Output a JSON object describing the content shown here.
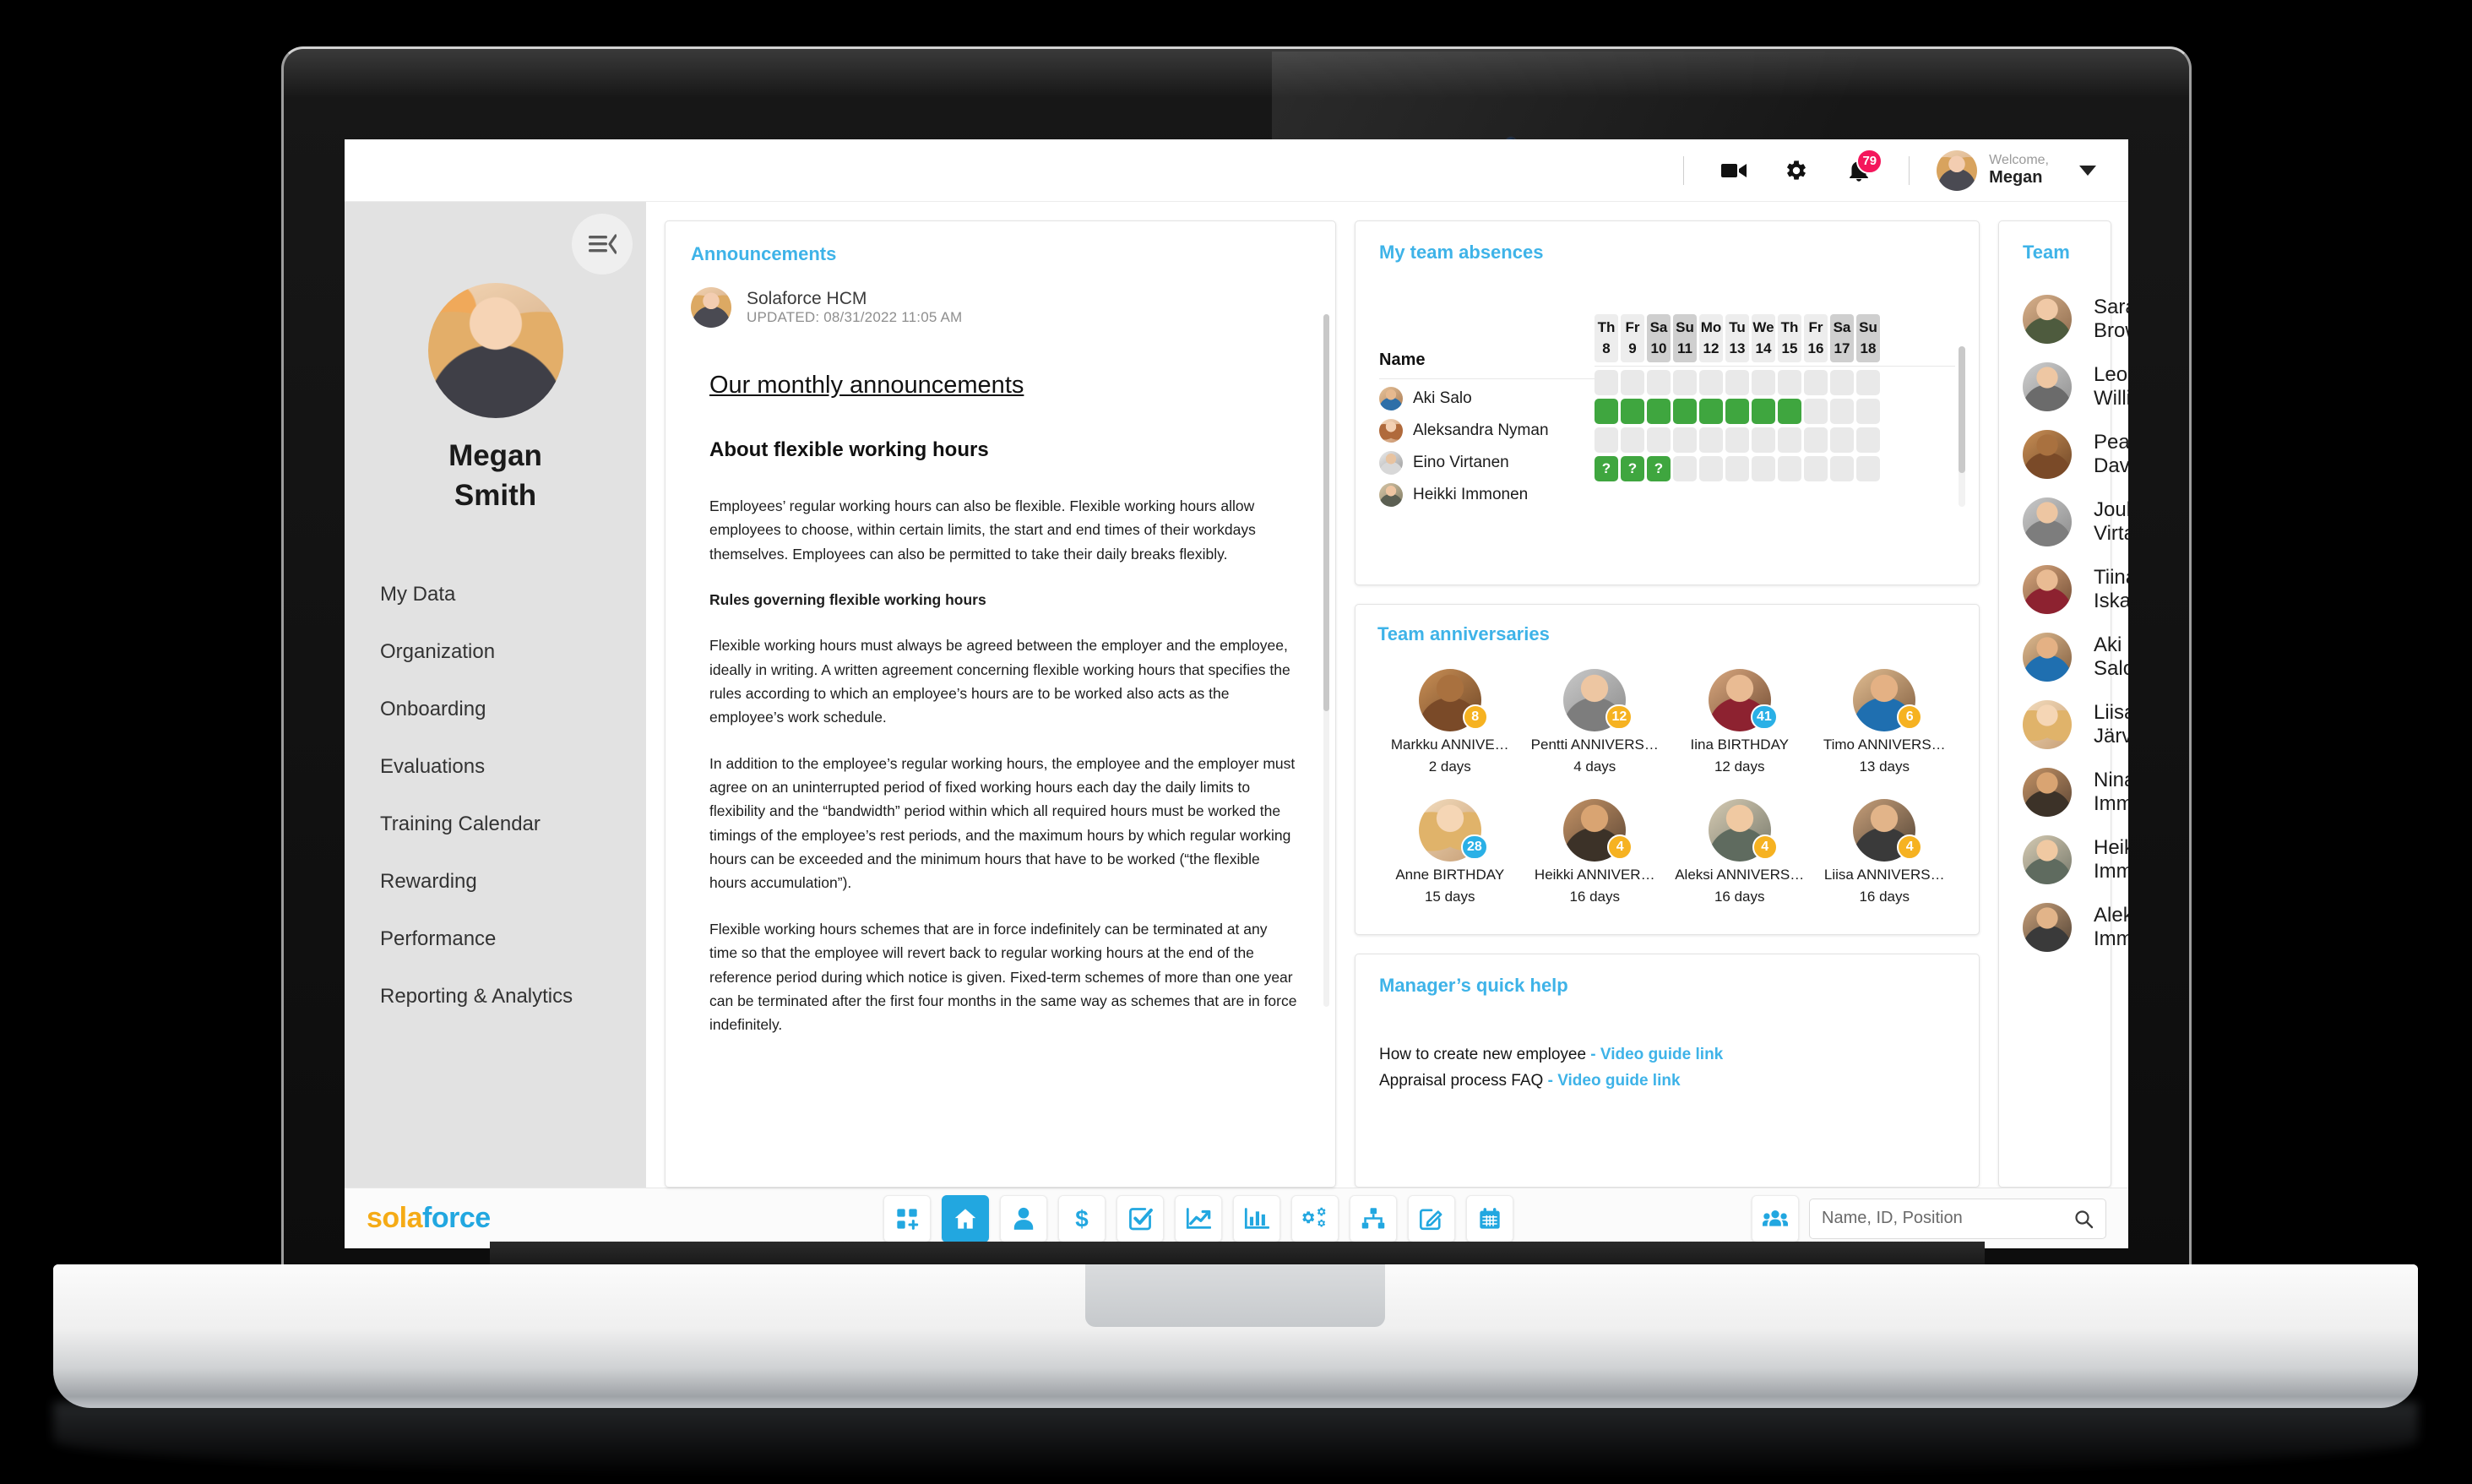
{
  "header": {
    "video_icon": "video-camera-icon",
    "settings_icon": "gear-icon",
    "notifications_icon": "bell-icon",
    "notification_count": "79",
    "welcome_label": "Welcome,",
    "user_name": "Megan",
    "dropdown_icon": "chevron-down-icon"
  },
  "sidebar": {
    "collapse_icon": "collapse-menu-icon",
    "profile": {
      "first_name": "Megan",
      "last_name": "Smith"
    },
    "items": [
      {
        "label": "My Data"
      },
      {
        "label": "Organization"
      },
      {
        "label": "Onboarding"
      },
      {
        "label": "Evaluations"
      },
      {
        "label": "Training Calendar"
      },
      {
        "label": "Rewarding"
      },
      {
        "label": "Performance"
      },
      {
        "label": "Reporting & Analytics"
      }
    ]
  },
  "announcements": {
    "title": "Announcements",
    "author": "Solaforce HCM",
    "updated": "UPDATED: 08/31/2022 11:05 AM",
    "heading": "Our monthly announcements",
    "subheading": "About flexible working hours",
    "paragraphs": [
      "Employees’ regular working hours can also be flexible. Flexible working hours allow employees to choose, within certain limits, the start and end times of their workdays themselves. Employees can also be permitted to take their daily breaks flexibly.",
      "Rules governing flexible working hours",
      "Flexible working hours must always be agreed between the employer and the employee, ideally in writing. A written agreement concerning flexible working hours that specifies the rules according to which an employee’s hours are to be worked also acts as the employee’s work schedule.",
      "In addition to the employee’s regular working hours, the employee and the employer must agree on an uninterrupted period of fixed working hours each day the daily limits to flexibility and the “bandwidth” period within which all required hours must be worked the timings of the employee’s rest periods, and the maximum hours by which regular working hours can be exceeded and the minimum hours that have to be worked (“the flexible hours accumulation”).",
      "Flexible working hours schemes that are in force indefinitely can be terminated at any time so that the employee will revert back to regular working hours at the end of the reference period during which notice is given. Fixed-term schemes of more than one year can be terminated after the first four months in the same way as schemes that are in force indefinitely."
    ]
  },
  "absences": {
    "title": "My team absences",
    "name_header": "Name",
    "days": [
      {
        "dow": "Th",
        "num": "8",
        "weekend": false
      },
      {
        "dow": "Fr",
        "num": "9",
        "weekend": false
      },
      {
        "dow": "Sa",
        "num": "10",
        "weekend": true
      },
      {
        "dow": "Su",
        "num": "11",
        "weekend": true
      },
      {
        "dow": "Mo",
        "num": "12",
        "weekend": false
      },
      {
        "dow": "Tu",
        "num": "13",
        "weekend": false
      },
      {
        "dow": "We",
        "num": "14",
        "weekend": false
      },
      {
        "dow": "Th",
        "num": "15",
        "weekend": false
      },
      {
        "dow": "Fr",
        "num": "16",
        "weekend": false
      },
      {
        "dow": "Sa",
        "num": "17",
        "weekend": true
      },
      {
        "dow": "Su",
        "num": "18",
        "weekend": true
      }
    ],
    "rows": [
      {
        "name": "Aki Salo",
        "cells": [
          "",
          "",
          "",
          "",
          "",
          "",
          "",
          "",
          "",
          "",
          ""
        ]
      },
      {
        "name": "Aleksandra Nyman",
        "cells": [
          "on",
          "on",
          "on",
          "on",
          "on",
          "on",
          "on",
          "on",
          "",
          "",
          ""
        ]
      },
      {
        "name": "Eino Virtanen",
        "cells": [
          "",
          "",
          "",
          "",
          "",
          "",
          "",
          "",
          "",
          "",
          ""
        ]
      },
      {
        "name": "Heikki Immonen",
        "cells": [
          "?",
          "?",
          "?",
          "",
          "",
          "",
          "",
          "",
          "",
          "",
          ""
        ]
      }
    ],
    "colors": {
      "absent": "#3fa63f",
      "empty": "#e9e9e9",
      "weekend_header": "#cfcfcf"
    }
  },
  "anniversaries": {
    "title": "Team anniversaries",
    "items": [
      {
        "name": "Markku ANNIVE…",
        "days": "2 days",
        "badge": "8",
        "badge_color": "#f6b221"
      },
      {
        "name": "Pentti ANNIVERS…",
        "days": "4 days",
        "badge": "12",
        "badge_color": "#f6b221"
      },
      {
        "name": "Iina BIRTHDAY",
        "days": "12 days",
        "badge": "41",
        "badge_color": "#2ab0e6"
      },
      {
        "name": "Timo ANNIVERS…",
        "days": "13 days",
        "badge": "6",
        "badge_color": "#f6b221"
      },
      {
        "name": "Anne BIRTHDAY",
        "days": "15 days",
        "badge": "28",
        "badge_color": "#2ab0e6"
      },
      {
        "name": "Heikki ANNIVER…",
        "days": "16 days",
        "badge": "4",
        "badge_color": "#f6b221"
      },
      {
        "name": "Aleksi ANNIVERS…",
        "days": "16 days",
        "badge": "4",
        "badge_color": "#f6b221"
      },
      {
        "name": "Liisa ANNIVERS…",
        "days": "16 days",
        "badge": "4",
        "badge_color": "#f6b221"
      }
    ]
  },
  "quick_help": {
    "title": "Manager’s quick help",
    "lines": [
      {
        "text": "How to create new employee",
        "link": "- Video guide link"
      },
      {
        "text": "Appraisal process FAQ",
        "link": "- Video guide link"
      }
    ]
  },
  "team": {
    "title": "Team",
    "members": [
      {
        "name": "Sarah Brown"
      },
      {
        "name": "Leo Williams"
      },
      {
        "name": "Pearl Davis"
      },
      {
        "name": "Jouko Virtanen"
      },
      {
        "name": "Tiina Iskanius"
      },
      {
        "name": "Aki Salo"
      },
      {
        "name": "Liisa Järvi"
      },
      {
        "name": "Nina Immonen"
      },
      {
        "name": "Heikki Immonen"
      },
      {
        "name": "Aleksi Immonen"
      }
    ]
  },
  "bottombar": {
    "logo_part1": "sola",
    "logo_part2": "force",
    "tools": [
      {
        "icon": "add-widget-icon",
        "active": false
      },
      {
        "icon": "home-icon",
        "active": true
      },
      {
        "icon": "person-icon",
        "active": false
      },
      {
        "icon": "dollar-icon",
        "active": false
      },
      {
        "icon": "checkbox-icon",
        "active": false
      },
      {
        "icon": "trending-up-icon",
        "active": false
      },
      {
        "icon": "bar-chart-icon",
        "active": false
      },
      {
        "icon": "gears-icon",
        "active": false
      },
      {
        "icon": "org-chart-icon",
        "active": false
      },
      {
        "icon": "edit-note-icon",
        "active": false
      },
      {
        "icon": "calendar-icon",
        "active": false
      }
    ],
    "people_icon": "people-group-icon",
    "search_placeholder": "Name, ID, Position",
    "search_value": "",
    "search_icon": "search-icon"
  },
  "colors": {
    "accent": "#3eb3e8",
    "brand_blue": "#22a7e0",
    "brand_orange": "#f5ab16",
    "absent_green": "#3fa63f",
    "badge_red": "#f4175c"
  }
}
